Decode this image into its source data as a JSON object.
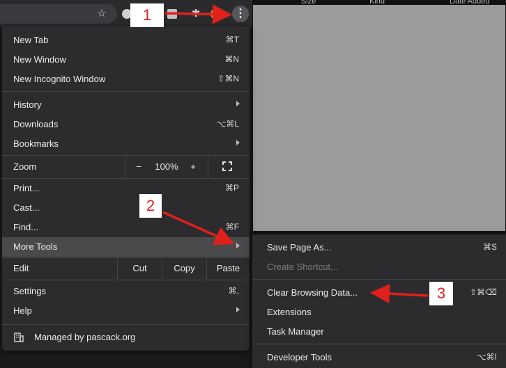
{
  "right_panel": {
    "columns": [
      "Size",
      "Kind",
      "Date Added"
    ]
  },
  "toolbar": {
    "star_icon": "star-icon",
    "kebab_icon": "more-vertical-icon"
  },
  "menu": {
    "new_tab": {
      "label": "New Tab",
      "shortcut": "⌘T"
    },
    "new_window": {
      "label": "New Window",
      "shortcut": "⌘N"
    },
    "new_incognito": {
      "label": "New Incognito Window",
      "shortcut": "⇧⌘N"
    },
    "history": {
      "label": "History"
    },
    "downloads": {
      "label": "Downloads",
      "shortcut": "⌥⌘L"
    },
    "bookmarks": {
      "label": "Bookmarks"
    },
    "zoom": {
      "label": "Zoom",
      "minus": "−",
      "value": "100%",
      "plus": "+"
    },
    "print": {
      "label": "Print...",
      "shortcut": "⌘P"
    },
    "cast": {
      "label": "Cast..."
    },
    "find": {
      "label": "Find...",
      "shortcut": "⌘F"
    },
    "more_tools": {
      "label": "More Tools"
    },
    "edit": {
      "label": "Edit",
      "cut": "Cut",
      "copy": "Copy",
      "paste": "Paste"
    },
    "settings": {
      "label": "Settings",
      "shortcut": "⌘,"
    },
    "help": {
      "label": "Help"
    },
    "managed": {
      "label": "Managed by pascack.org"
    }
  },
  "submenu": {
    "save_page": {
      "label": "Save Page As...",
      "shortcut": "⌘S"
    },
    "create_shortcut": {
      "label": "Create Shortcut..."
    },
    "clear_browsing": {
      "label": "Clear Browsing Data...",
      "shortcut": "⇧⌘⌫"
    },
    "extensions": {
      "label": "Extensions"
    },
    "task_manager": {
      "label": "Task Manager"
    },
    "developer_tools": {
      "label": "Developer Tools",
      "shortcut": "⌥⌘I"
    }
  },
  "callouts": {
    "one": "1",
    "two": "2",
    "three": "3"
  },
  "colors": {
    "menu_bg": "#2c2c2e",
    "highlight": "#4a4a4c",
    "callout_text": "#e0201b",
    "arrow": "#e0201b"
  }
}
